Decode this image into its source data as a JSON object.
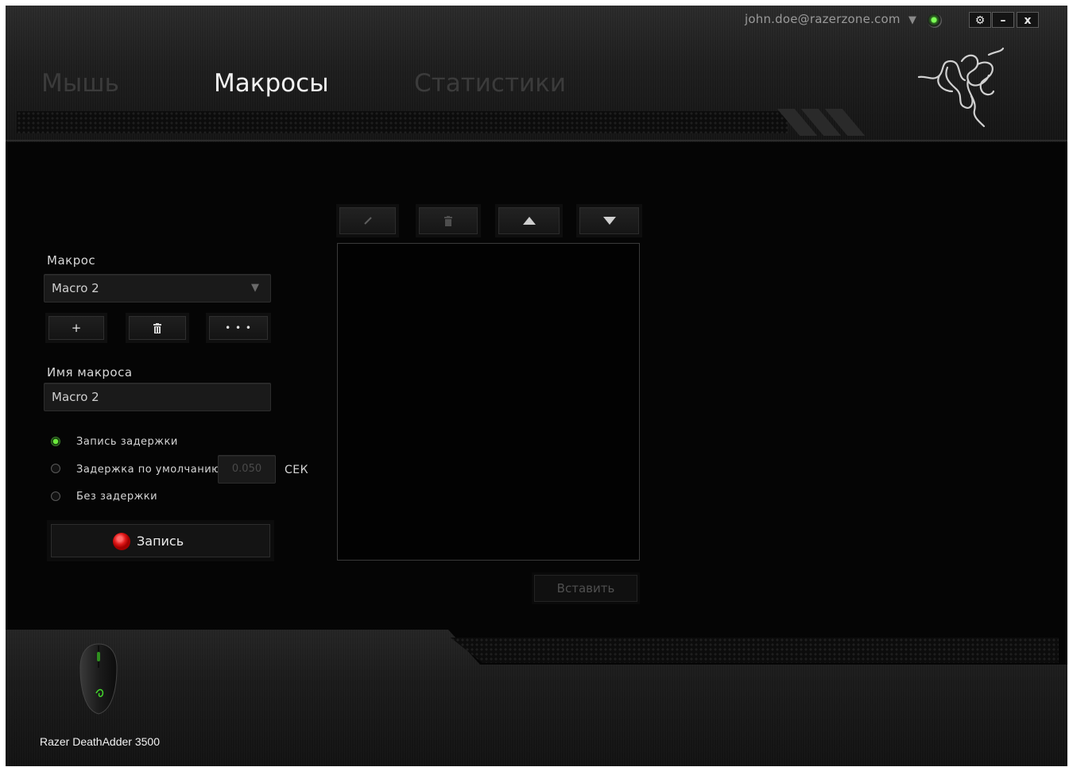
{
  "header": {
    "account_email": "john.doe@razerzone.com",
    "tabs": [
      {
        "label": "Мышь",
        "active": false
      },
      {
        "label": "Макросы",
        "active": true
      },
      {
        "label": "Статистики",
        "active": false
      }
    ],
    "window_buttons": {
      "settings": "⚙",
      "minimize": "–",
      "close": "x"
    }
  },
  "macro_panel": {
    "macro_label": "Макрос",
    "macro_selected": "Macro 2",
    "add_button": "+",
    "delete_button": "🗑",
    "more_button": "• • •",
    "name_label": "Имя макроса",
    "name_value": "Macro 2",
    "delay_options": [
      {
        "label": "Запись задержки",
        "selected": true
      },
      {
        "label": "Задержка по умолчанию",
        "selected": false
      },
      {
        "label": "Без задержки",
        "selected": false
      }
    ],
    "default_delay_value": "0.050",
    "delay_unit": "СЕК",
    "record_button": "Запись"
  },
  "editor": {
    "insert_button": "Вставить"
  },
  "footer": {
    "device_name": "Razer DeathAdder 3500"
  },
  "colors": {
    "accent_green": "#44d62c",
    "record_red": "#e01919",
    "background": "#050505"
  }
}
